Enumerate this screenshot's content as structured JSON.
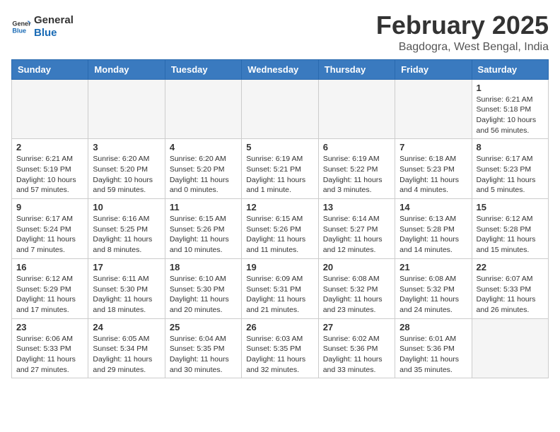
{
  "header": {
    "logo_line1": "General",
    "logo_line2": "Blue",
    "month": "February 2025",
    "location": "Bagdogra, West Bengal, India"
  },
  "weekdays": [
    "Sunday",
    "Monday",
    "Tuesday",
    "Wednesday",
    "Thursday",
    "Friday",
    "Saturday"
  ],
  "weeks": [
    [
      {
        "day": "",
        "info": ""
      },
      {
        "day": "",
        "info": ""
      },
      {
        "day": "",
        "info": ""
      },
      {
        "day": "",
        "info": ""
      },
      {
        "day": "",
        "info": ""
      },
      {
        "day": "",
        "info": ""
      },
      {
        "day": "1",
        "info": "Sunrise: 6:21 AM\nSunset: 5:18 PM\nDaylight: 10 hours and 56 minutes."
      }
    ],
    [
      {
        "day": "2",
        "info": "Sunrise: 6:21 AM\nSunset: 5:19 PM\nDaylight: 10 hours and 57 minutes."
      },
      {
        "day": "3",
        "info": "Sunrise: 6:20 AM\nSunset: 5:20 PM\nDaylight: 10 hours and 59 minutes."
      },
      {
        "day": "4",
        "info": "Sunrise: 6:20 AM\nSunset: 5:20 PM\nDaylight: 11 hours and 0 minutes."
      },
      {
        "day": "5",
        "info": "Sunrise: 6:19 AM\nSunset: 5:21 PM\nDaylight: 11 hours and 1 minute."
      },
      {
        "day": "6",
        "info": "Sunrise: 6:19 AM\nSunset: 5:22 PM\nDaylight: 11 hours and 3 minutes."
      },
      {
        "day": "7",
        "info": "Sunrise: 6:18 AM\nSunset: 5:23 PM\nDaylight: 11 hours and 4 minutes."
      },
      {
        "day": "8",
        "info": "Sunrise: 6:17 AM\nSunset: 5:23 PM\nDaylight: 11 hours and 5 minutes."
      }
    ],
    [
      {
        "day": "9",
        "info": "Sunrise: 6:17 AM\nSunset: 5:24 PM\nDaylight: 11 hours and 7 minutes."
      },
      {
        "day": "10",
        "info": "Sunrise: 6:16 AM\nSunset: 5:25 PM\nDaylight: 11 hours and 8 minutes."
      },
      {
        "day": "11",
        "info": "Sunrise: 6:15 AM\nSunset: 5:26 PM\nDaylight: 11 hours and 10 minutes."
      },
      {
        "day": "12",
        "info": "Sunrise: 6:15 AM\nSunset: 5:26 PM\nDaylight: 11 hours and 11 minutes."
      },
      {
        "day": "13",
        "info": "Sunrise: 6:14 AM\nSunset: 5:27 PM\nDaylight: 11 hours and 12 minutes."
      },
      {
        "day": "14",
        "info": "Sunrise: 6:13 AM\nSunset: 5:28 PM\nDaylight: 11 hours and 14 minutes."
      },
      {
        "day": "15",
        "info": "Sunrise: 6:12 AM\nSunset: 5:28 PM\nDaylight: 11 hours and 15 minutes."
      }
    ],
    [
      {
        "day": "16",
        "info": "Sunrise: 6:12 AM\nSunset: 5:29 PM\nDaylight: 11 hours and 17 minutes."
      },
      {
        "day": "17",
        "info": "Sunrise: 6:11 AM\nSunset: 5:30 PM\nDaylight: 11 hours and 18 minutes."
      },
      {
        "day": "18",
        "info": "Sunrise: 6:10 AM\nSunset: 5:30 PM\nDaylight: 11 hours and 20 minutes."
      },
      {
        "day": "19",
        "info": "Sunrise: 6:09 AM\nSunset: 5:31 PM\nDaylight: 11 hours and 21 minutes."
      },
      {
        "day": "20",
        "info": "Sunrise: 6:08 AM\nSunset: 5:32 PM\nDaylight: 11 hours and 23 minutes."
      },
      {
        "day": "21",
        "info": "Sunrise: 6:08 AM\nSunset: 5:32 PM\nDaylight: 11 hours and 24 minutes."
      },
      {
        "day": "22",
        "info": "Sunrise: 6:07 AM\nSunset: 5:33 PM\nDaylight: 11 hours and 26 minutes."
      }
    ],
    [
      {
        "day": "23",
        "info": "Sunrise: 6:06 AM\nSunset: 5:33 PM\nDaylight: 11 hours and 27 minutes."
      },
      {
        "day": "24",
        "info": "Sunrise: 6:05 AM\nSunset: 5:34 PM\nDaylight: 11 hours and 29 minutes."
      },
      {
        "day": "25",
        "info": "Sunrise: 6:04 AM\nSunset: 5:35 PM\nDaylight: 11 hours and 30 minutes."
      },
      {
        "day": "26",
        "info": "Sunrise: 6:03 AM\nSunset: 5:35 PM\nDaylight: 11 hours and 32 minutes."
      },
      {
        "day": "27",
        "info": "Sunrise: 6:02 AM\nSunset: 5:36 PM\nDaylight: 11 hours and 33 minutes."
      },
      {
        "day": "28",
        "info": "Sunrise: 6:01 AM\nSunset: 5:36 PM\nDaylight: 11 hours and 35 minutes."
      },
      {
        "day": "",
        "info": ""
      }
    ]
  ]
}
